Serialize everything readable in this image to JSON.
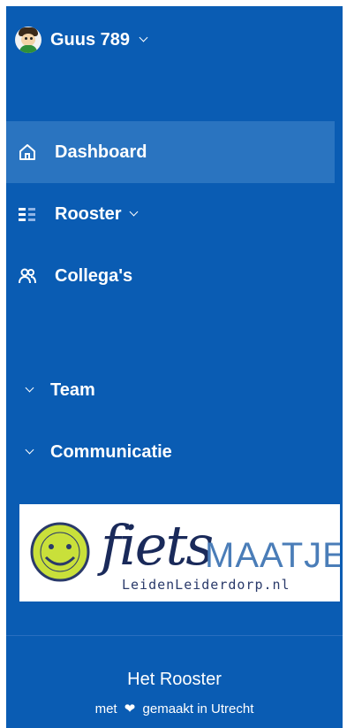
{
  "user": {
    "name": "Guus 789"
  },
  "nav": {
    "items": [
      {
        "label": "Dashboard",
        "icon": "home-icon",
        "active": true
      },
      {
        "label": "Rooster",
        "icon": "list-icon",
        "has_dropdown": true
      },
      {
        "label": "Collega's",
        "icon": "users-icon"
      }
    ]
  },
  "groups": [
    {
      "label": "Team"
    },
    {
      "label": "Communicatie"
    }
  ],
  "logo": {
    "word1": "fiets",
    "word2": "MAATJES",
    "domain": "LeidenLeiderdorp.nl"
  },
  "footer": {
    "title": "Het Rooster",
    "prefix": "met",
    "heart": "❤",
    "suffix": "gemaakt in Utrecht"
  },
  "colors": {
    "sidebar": "#0a5cb3",
    "active": "#2a74c0",
    "white": "#ffffff"
  }
}
